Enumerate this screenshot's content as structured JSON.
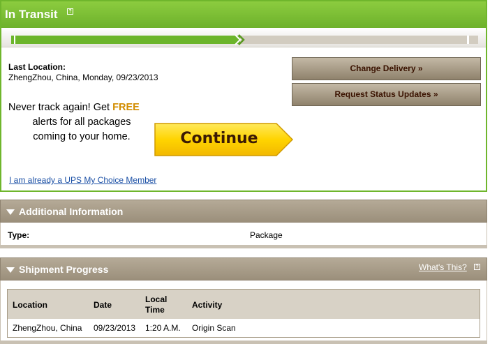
{
  "status": {
    "title": "In Transit",
    "help_icon": "?",
    "progress_fraction": 0.49
  },
  "last_location": {
    "label": "Last Location:",
    "value": "ZhengZhou, China, Monday, 09/23/2013"
  },
  "actions": {
    "change_delivery": "Change Delivery »",
    "request_status": "Request Status Updates »"
  },
  "promo": {
    "line1_prefix": "Never track again! Get",
    "free": "FREE",
    "line2": "alerts for all packages",
    "line3": "coming to your home.",
    "continue_label": "Continue",
    "member_link": "I am already a UPS My Choice Member"
  },
  "additional_info": {
    "title": "Additional Information",
    "type_label": "Type:",
    "type_value": "Package"
  },
  "shipment_progress": {
    "title": "Shipment Progress",
    "whats_this": "What's This?",
    "help_icon": "?",
    "columns": {
      "location": "Location",
      "date": "Date",
      "local_time_1": "Local",
      "local_time_2": "Time",
      "activity": "Activity"
    },
    "rows": [
      {
        "location": "ZhengZhou, China",
        "date": "09/23/2013",
        "time": "1:20 A.M.",
        "activity": "Origin Scan"
      }
    ]
  },
  "colors": {
    "header_green": "#6db12b",
    "button_brown": "#9b8f7b",
    "free_orange": "#d28d00",
    "continue_yellow": "#ffd400",
    "link_blue": "#1a4fa5"
  }
}
